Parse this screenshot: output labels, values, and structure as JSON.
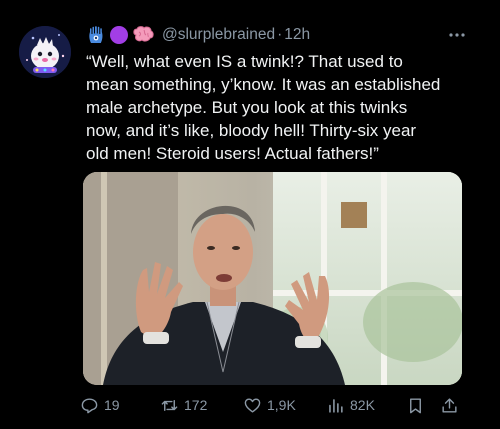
{
  "post": {
    "handle": "@slurplebrained",
    "separator": "·",
    "time": "12h",
    "text": "“Well, what even IS a twink!? That used to\nmean something, y’know. It was an established\nmale archetype. But you look at this twinks\nnow, and it’s like, bloody hell! Thirty-six year\nold men! Steroid users! Actual fathers!”",
    "badges": [
      "hamsa-icon",
      "purple-circle-emoji",
      "brain-emoji"
    ]
  },
  "actions": {
    "replies": "19",
    "reposts": "172",
    "likes": "1,9K",
    "views": "82K"
  },
  "colors": {
    "background": "#000000",
    "text": "#e7e9ea",
    "muted": "#8b98a5",
    "badge_purple": "#a23ee6"
  }
}
